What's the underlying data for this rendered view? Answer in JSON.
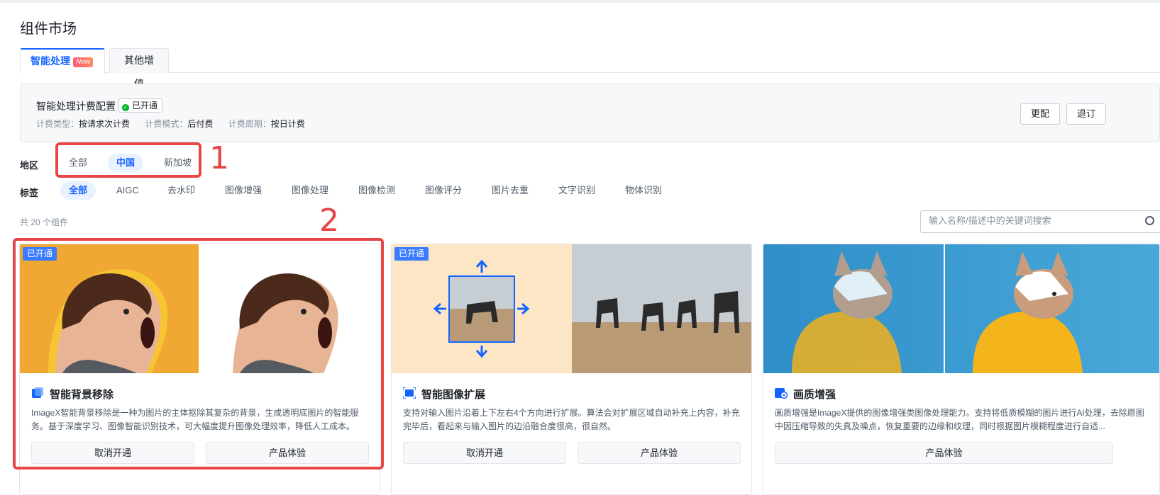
{
  "page_title": "组件市场",
  "tabs": [
    {
      "label": "智能处理",
      "badge": "New",
      "active": true
    },
    {
      "label": "其他增值",
      "active": false
    }
  ],
  "billing": {
    "title": "智能处理计费配置",
    "status": "已开通",
    "billing_type_label": "计费类型：",
    "billing_type_value": "按请求次计费",
    "billing_mode_label": "计费模式：",
    "billing_mode_value": "后付费",
    "billing_cycle_label": "计费周期：",
    "billing_cycle_value": "按日计费",
    "change_button": "更配",
    "unsubscribe_button": "退订"
  },
  "region": {
    "label": "地区",
    "options": [
      "全部",
      "中国",
      "新加坡"
    ],
    "selected": "中国"
  },
  "tags": {
    "label": "标签",
    "options": [
      "全部",
      "AIGC",
      "去水印",
      "图像增强",
      "图像处理",
      "图像检测",
      "图像评分",
      "图片去重",
      "文字识别",
      "物体识别"
    ],
    "selected": "全部"
  },
  "annotations": [
    "1",
    "2"
  ],
  "count_text": "共 20 个组件",
  "search": {
    "placeholder": "输入名称/描述中的关键词搜索"
  },
  "cards": [
    {
      "opened_badge": "已开通",
      "title": "智能背景移除",
      "description": "ImageX智能背景移除是一种为图片的主体抠除其复杂的背景，生成透明底图片的智能服务。基于深度学习、图像智能识别技术，可大幅度提升图像处理效率，降低人工成本。",
      "buttons": [
        "取消开通",
        "产品体验"
      ]
    },
    {
      "opened_badge": "已开通",
      "title": "智能图像扩展",
      "description": "支持对输入图片沿着上下左右4个方向进行扩展。算法会对扩展区域自动补充上内容，补充完毕后，看起来与输入图片的边沿融合度很高，很自然。",
      "buttons": [
        "取消开通",
        "产品体验"
      ]
    },
    {
      "opened_badge": "",
      "title": "画质增强",
      "description": "画质增强是ImageX提供的图像增强类图像处理能力。支持将低质模糊的图片进行AI处理，去除原图中因压缩导致的失真及噪点，恢复重要的边缘和纹理，同时根据图片模糊程度进行自适...",
      "buttons": [
        "产品体验"
      ]
    }
  ],
  "colors": {
    "accent": "#1664ff",
    "annotation": "#e84646",
    "opened_badge": "#3a7bff"
  }
}
